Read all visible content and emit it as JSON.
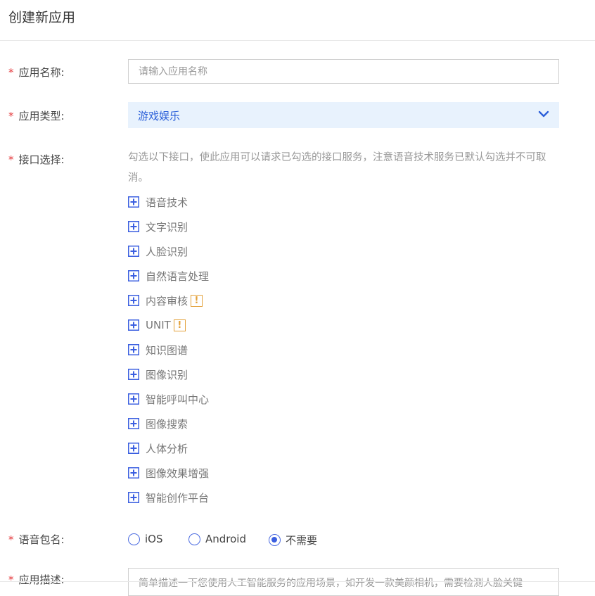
{
  "header": {
    "title": "创建新应用"
  },
  "required_mark": "*",
  "form": {
    "name": {
      "label": "应用名称:",
      "placeholder": "请输入应用名称",
      "value": ""
    },
    "type": {
      "label": "应用类型:",
      "value": "游戏娱乐"
    },
    "apis": {
      "label": "接口选择:",
      "hint": "勾选以下接口，使此应用可以请求已勾选的接口服务，注意语音技术服务已默认勾选并不可取消。",
      "items": [
        {
          "label": "语音技术",
          "warning": ""
        },
        {
          "label": "文字识别",
          "warning": ""
        },
        {
          "label": "人脸识别",
          "warning": ""
        },
        {
          "label": "自然语言处理",
          "warning": ""
        },
        {
          "label": "内容审核",
          "warning": "!"
        },
        {
          "label": "UNIT",
          "warning": "!"
        },
        {
          "label": "知识图谱",
          "warning": ""
        },
        {
          "label": "图像识别",
          "warning": ""
        },
        {
          "label": "智能呼叫中心",
          "warning": ""
        },
        {
          "label": "图像搜索",
          "warning": ""
        },
        {
          "label": "人体分析",
          "warning": ""
        },
        {
          "label": "图像效果增强",
          "warning": ""
        },
        {
          "label": "智能创作平台",
          "warning": ""
        }
      ]
    },
    "package": {
      "label": "语音包名:",
      "options": [
        "iOS",
        "Android",
        "不需要"
      ],
      "selected": "不需要"
    },
    "description": {
      "label": "应用描述:",
      "placeholder": "简单描述一下您使用人工智能服务的应用场景，如开发一款美颜相机，需要检测人脸关键"
    }
  },
  "icons": {
    "expand": "plus-square-icon",
    "dropdown": "chevron-down-icon",
    "warning": "exclamation-icon"
  },
  "colors": {
    "accent": "#3b5fe0",
    "required": "#e4393c",
    "warning": "#e3a13a",
    "select_bg": "#e8f2fd"
  }
}
